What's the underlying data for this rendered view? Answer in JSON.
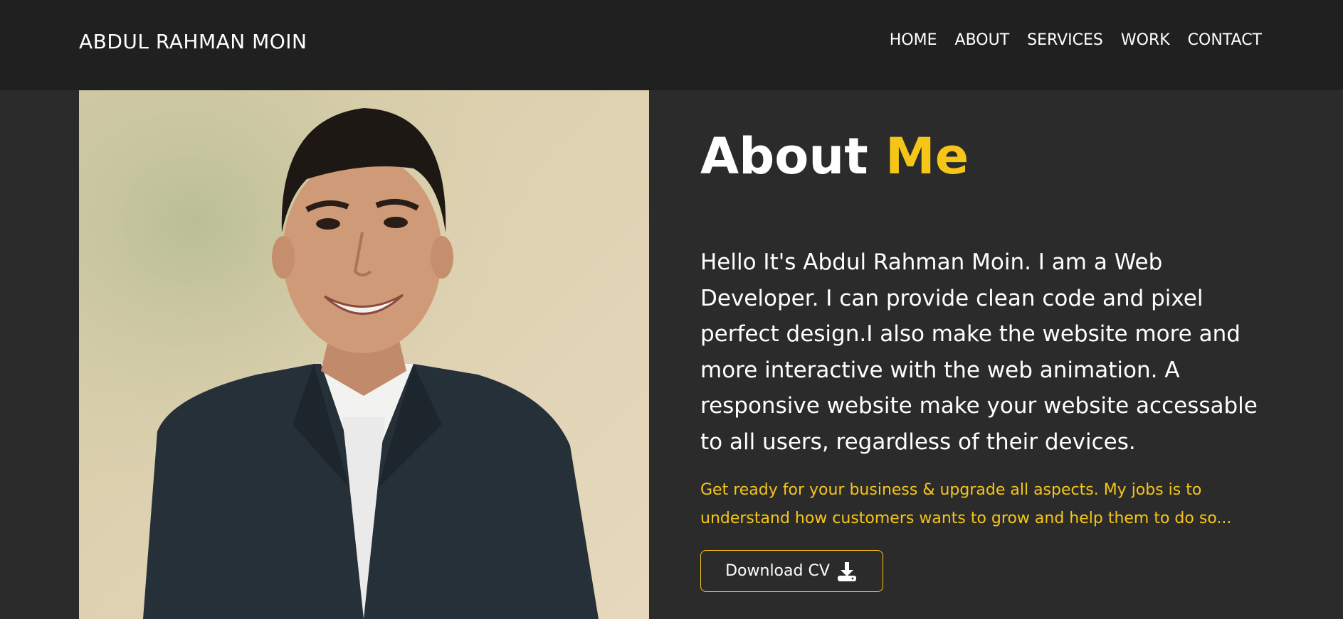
{
  "header": {
    "brand": "ABDUL RAHMAN MOIN",
    "nav": [
      {
        "label": "HOME"
      },
      {
        "label": "ABOUT"
      },
      {
        "label": "SERVICES"
      },
      {
        "label": "WORK"
      },
      {
        "label": "CONTACT"
      }
    ]
  },
  "about": {
    "title_word": "About",
    "title_accent": "Me",
    "bio": "Hello It's Abdul Rahman Moin. I am a Web Developer. I can provide clean code and pixel perfect design.I also make the website more and more interactive with the web animation. A responsive website make your website accessable to all users, regardless of their devices.",
    "tagline": "Get ready for your business & upgrade all aspects. My jobs is to understand how customers wants to grow and help them to do so...",
    "button_label": "Download CV",
    "button_icon": "download-icon"
  },
  "colors": {
    "accent": "#f5c518",
    "header_bg": "#202020",
    "page_bg": "#2b2b2b",
    "text": "#ffffff"
  }
}
